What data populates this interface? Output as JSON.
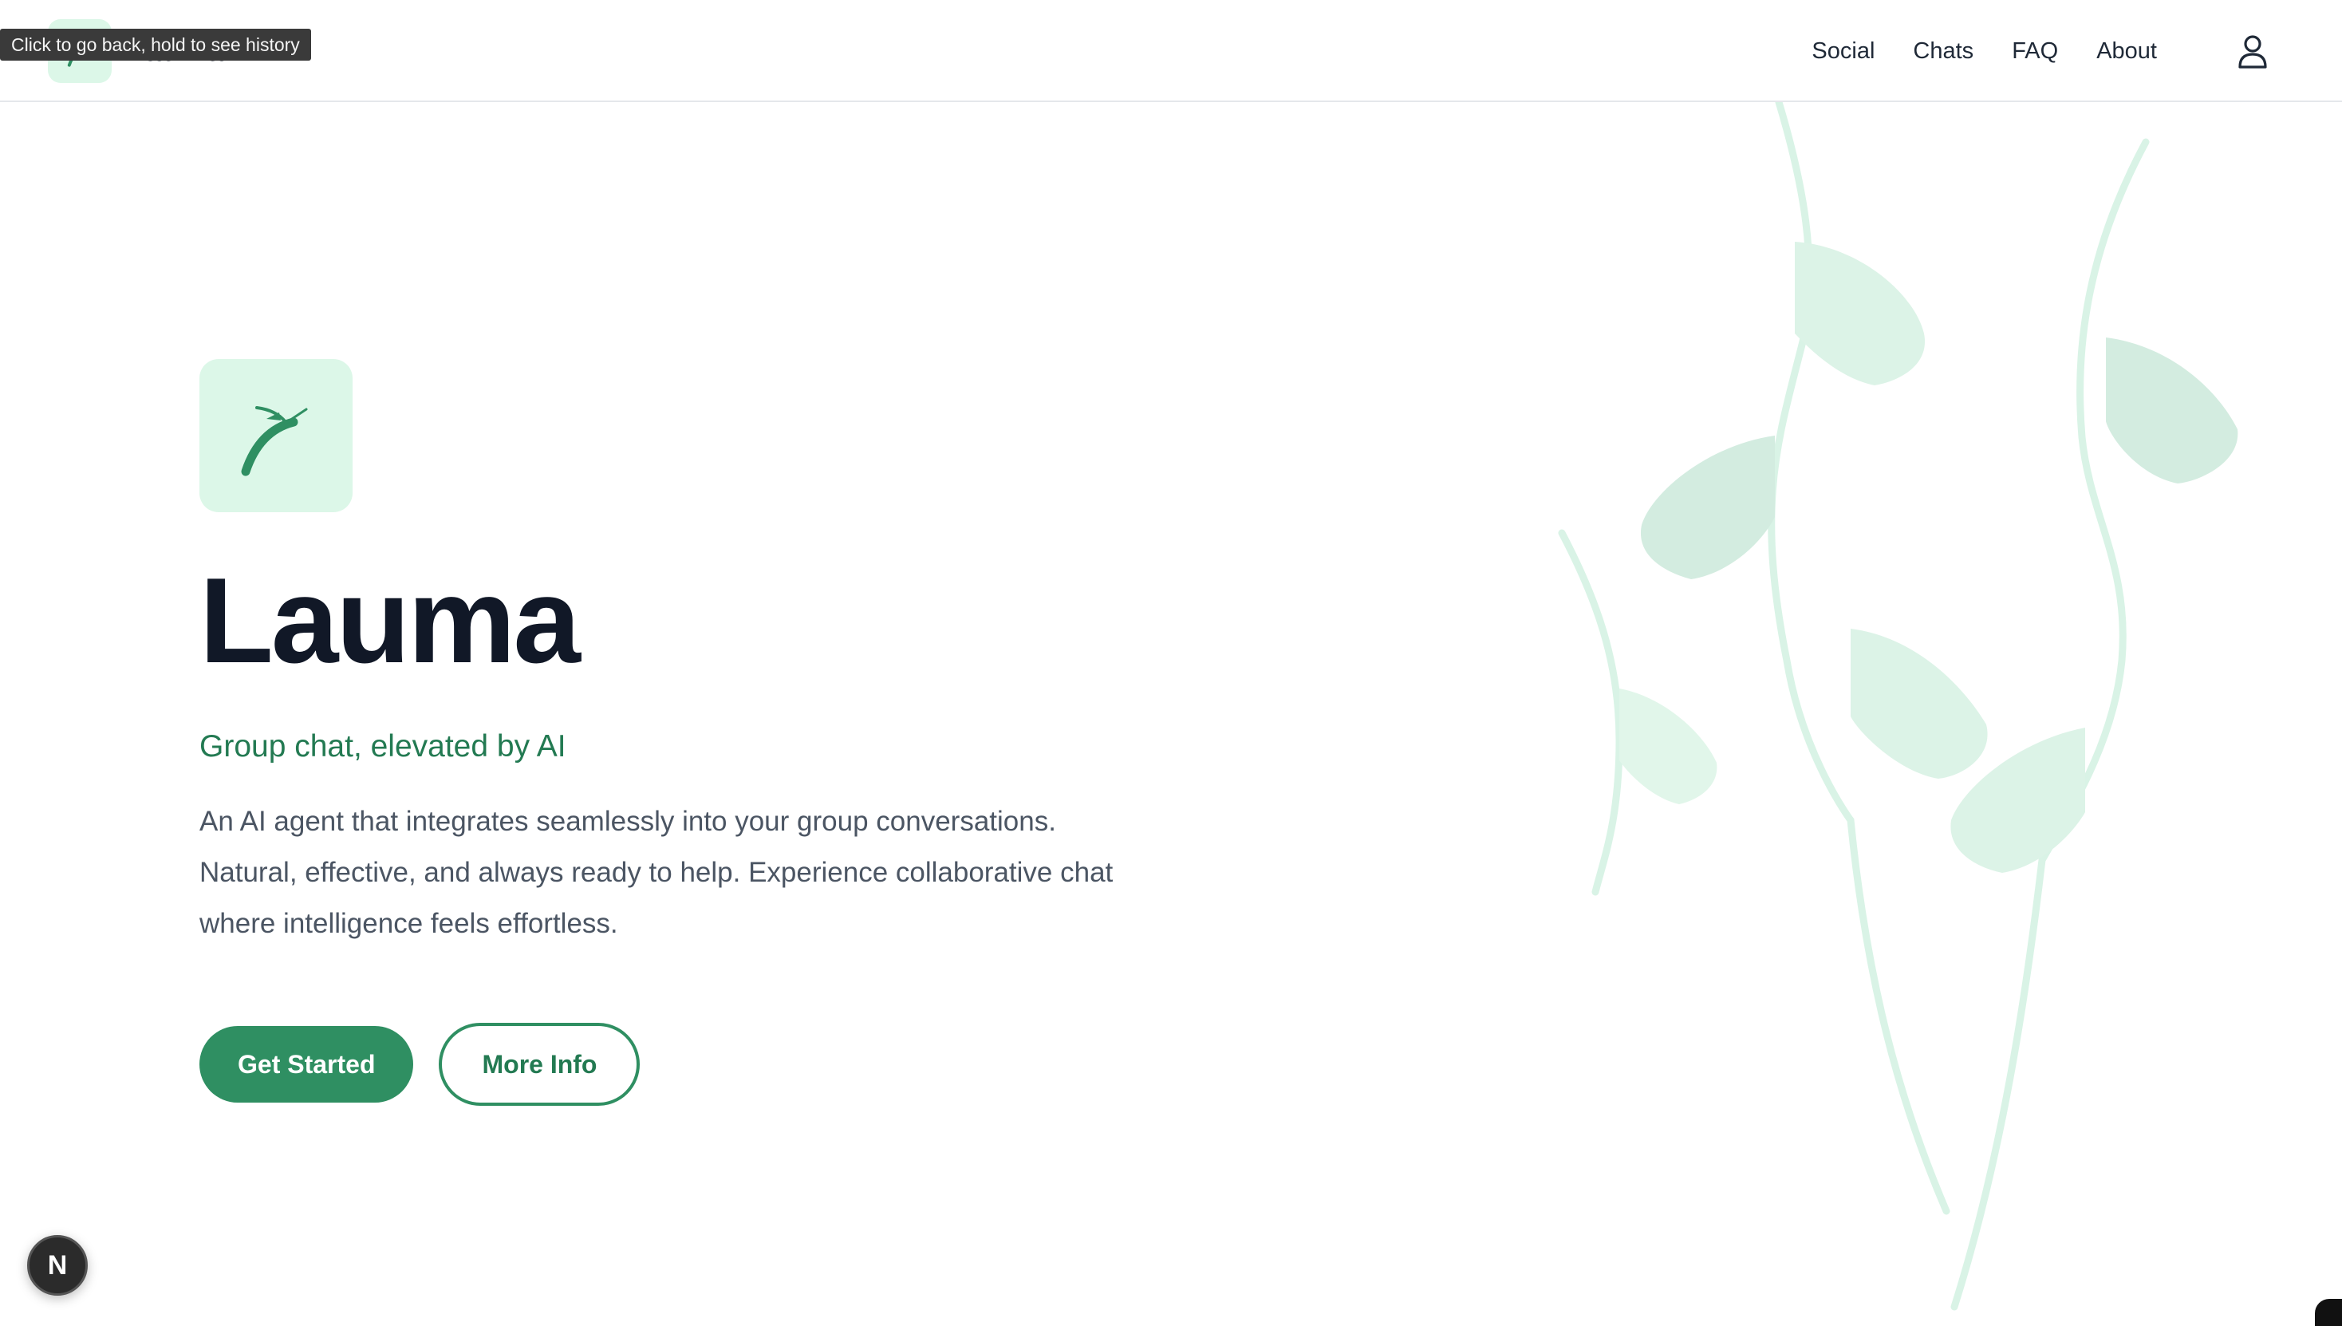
{
  "header": {
    "brand_name": "Lauma",
    "nav": [
      {
        "label": "Social"
      },
      {
        "label": "Chats"
      },
      {
        "label": "FAQ"
      },
      {
        "label": "About"
      }
    ],
    "user_icon": "user-icon"
  },
  "tooltip": "Click to go back, hold to see history",
  "hero": {
    "title": "Lauma",
    "subtitle": "Group chat, elevated by AI",
    "description": "An AI agent that integrates seamlessly into your group conversations. Natural, effective, and always ready to help. Experience collaborative chat where intelligence feels effortless.",
    "primary_button": "Get Started",
    "secondary_button": "More Info"
  },
  "dev_badge": "N",
  "colors": {
    "accent": "#2f8f62",
    "accent_text": "#237a52",
    "logo_bg": "#dcf7e8",
    "leaf": "#cfeee0"
  }
}
